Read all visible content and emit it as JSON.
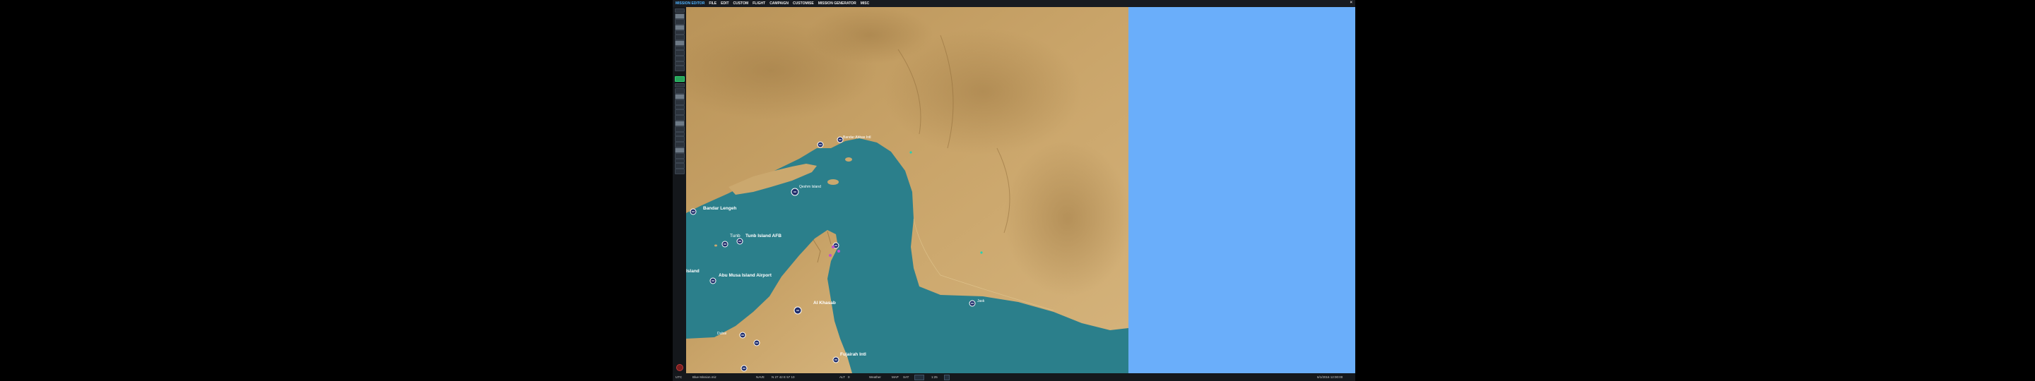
{
  "app": {
    "title": "MISSION EDITOR",
    "menu": [
      "FILE",
      "EDIT",
      "CUSTOM",
      "FLIGHT",
      "CAMPAIGN",
      "CUSTOMISE",
      "MISSION GENERATOR",
      "MISC"
    ],
    "close_glyph": "×"
  },
  "map": {
    "labels": {
      "bandar_lengeh": "Bandar Lengeh",
      "tunb_island": "Tunb Island AFB",
      "tunb_kochak": "Tunb",
      "abu_musa": "Abu Musa Island Airport",
      "island_left": "Island",
      "al_khasab": "Al Khasab",
      "fujairah": "Fujairah Intl",
      "qeshm": "Qeshm Island",
      "bandar_abbas": "Bandar Abbas Intl",
      "jask": "Jask",
      "dubai": "Dubai"
    }
  },
  "status": {
    "left_field": "UTC",
    "scenario": "Blue Mission.miz",
    "mode": "NAVE",
    "coords": "N 27 42 E 57 10",
    "alt_label": "ALT",
    "alt_value": "0",
    "weather": "Weather",
    "map_btn": "MAP",
    "sat_btn": "SAT",
    "zoom": "1:25",
    "time": "6/1/2016 12:00:00"
  },
  "colors": {
    "land": "#c9a469",
    "sea": "#2b7f8b",
    "ocean_blank": "#6aaefa",
    "accent": "#4fb3ff"
  }
}
